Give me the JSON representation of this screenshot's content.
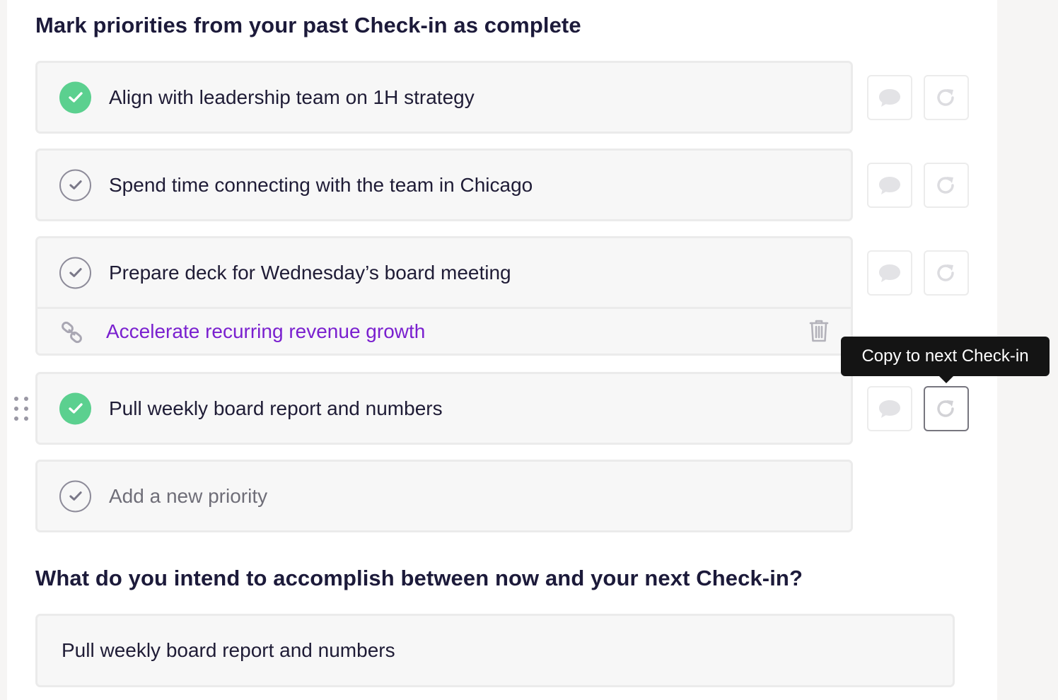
{
  "section_past": {
    "title": "Mark priorities from your past Check-in as complete",
    "priorities": [
      {
        "text": "Align with leadership team on 1H strategy",
        "completed": true
      },
      {
        "text": "Spend time connecting with the team in Chicago",
        "completed": false
      },
      {
        "text": "Prepare deck for Wednesday’s board meeting",
        "completed": false,
        "linked_goal": "Accelerate recurring revenue growth"
      },
      {
        "text": "Pull weekly board report and numbers",
        "completed": true
      }
    ],
    "add_placeholder": "Add a new priority"
  },
  "tooltip": {
    "text": "Copy to next Check-in"
  },
  "section_next": {
    "title": "What do you intend to accomplish between now and your next Check-in?",
    "value": "Pull weekly board report and numbers"
  },
  "colors": {
    "complete_green": "#5bd08f",
    "goal_link_purple": "#7a20cf",
    "heading": "#1c1a3a"
  },
  "icons": {
    "complete": "check-icon",
    "comment": "comment-icon",
    "copy": "redo-icon",
    "link": "link-icon",
    "delete": "trash-icon",
    "drag": "drag-handle-icon"
  }
}
